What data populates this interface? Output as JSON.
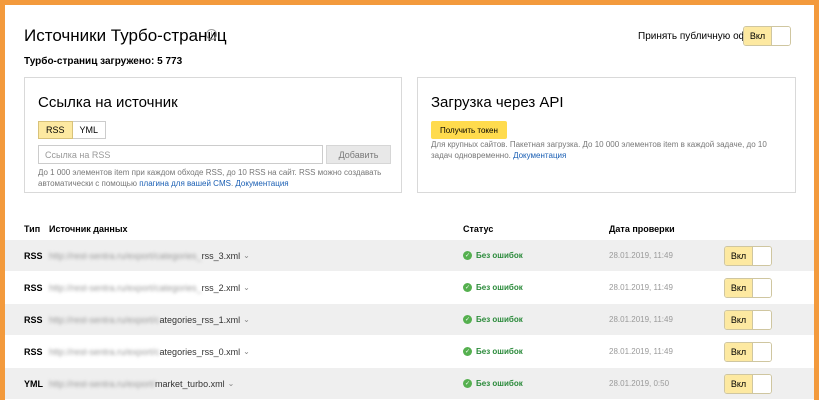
{
  "header": {
    "title": "Источники Турбо-страниц",
    "info_icon": "i",
    "loaded": "Турбо-страниц загружено: 5 773",
    "offer_label": "Принять публичную оферту",
    "offer_toggle": "Вкл"
  },
  "source_card": {
    "title": "Ссылка на источник",
    "tabs": [
      "RSS",
      "YML"
    ],
    "active_tab": "RSS",
    "input_placeholder": "Ссылка на RSS",
    "add_button": "Добавить",
    "hint_line1": "До 1 000 элементов item при каждом обходе RSS, до 10 RSS на сайт. RSS можно создавать",
    "hint_line2_prefix": "автоматически с помощью ",
    "hint_link_plugin": "плагина для вашей CMS",
    "hint_separator": ". ",
    "hint_link_docs": "Документация"
  },
  "api_card": {
    "title": "Загрузка через API",
    "token_button": "Получить токен",
    "hint_line1": "Для крупных сайтов. Пакетная загрузка. До 10 000 элементов item в каждой задаче, до 10",
    "hint_line2_prefix": "задач одновременно. ",
    "hint_link_docs": "Документация"
  },
  "table": {
    "headers": {
      "type": "Тип",
      "source": "Источник данных",
      "status": "Статус",
      "date": "Дата проверки"
    },
    "rows": [
      {
        "type": "RSS",
        "source_blur": "http://rest-sentra.ru/export/categories_",
        "source_tail": "rss_3.xml",
        "status": "Без ошибок",
        "date": "28.01.2019, 11:49",
        "toggle": "Вкл"
      },
      {
        "type": "RSS",
        "source_blur": "http://rest-sentra.ru/export/categories_",
        "source_tail": "rss_2.xml",
        "status": "Без ошибок",
        "date": "28.01.2019, 11:49",
        "toggle": "Вкл"
      },
      {
        "type": "RSS",
        "source_blur": "http://rest-sentra.ru/export/c",
        "source_tail": "ategories_rss_1.xml",
        "status": "Без ошибок",
        "date": "28.01.2019, 11:49",
        "toggle": "Вкл"
      },
      {
        "type": "RSS",
        "source_blur": "http://rest-sentra.ru/export/c",
        "source_tail": "ategories_rss_0.xml",
        "status": "Без ошибок",
        "date": "28.01.2019, 11:49",
        "toggle": "Вкл"
      },
      {
        "type": "YML",
        "source_blur": "http://rest-sentra.ru/export/",
        "source_tail": "market_turbo.xml",
        "status": "Без ошибок",
        "date": "28.01.2019, 0:50",
        "toggle": "Вкл"
      }
    ]
  },
  "colors": {
    "frame_border": "#f39a3c",
    "toggle_on": "#fde9a1",
    "token_button": "#ffdb4d",
    "status_ok": "#2a8a3a",
    "row_shade": "#efefef",
    "link": "#1a5fb4"
  }
}
